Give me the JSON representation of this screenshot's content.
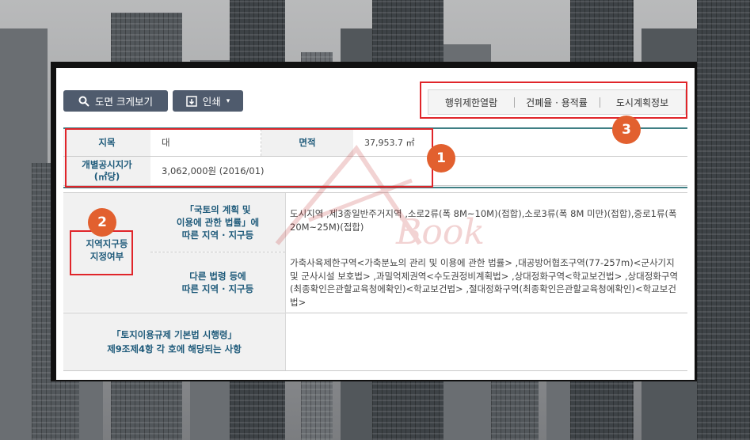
{
  "toolbar": {
    "zoom_button_label": "도면 크게보기",
    "print_button_label": "인쇄",
    "print_caret": "▾"
  },
  "tabs": [
    "행위제한열람",
    "건폐율 · 용적률",
    "도시계획정보"
  ],
  "land_info": {
    "category_label": "지목",
    "category_value": "대",
    "area_label": "면적",
    "area_value": "37,953.7 ㎡",
    "price_label_line1": "개별공시지가",
    "price_label_line2": "(㎡당)",
    "price_value": "3,062,000원 (2016/01)"
  },
  "zoning": {
    "section_label_line1": "지역지구등",
    "section_label_line2": "지정여부",
    "row1_label_line1": "「국토의 계획 및",
    "row1_label_line2": "이용에 관한 법률」에",
    "row1_label_line3": "따른 지역 · 지구등",
    "row1_value": "도시지역 ,제3종일반주거지역 ,소로2류(폭 8M~10M)(접합),소로3류(폭 8M 미만)(접합),중로1류(폭 20M~25M)(접합)",
    "row2_label_line1": "다른 법령 등에",
    "row2_label_line2": "따른 지역 · 지구등",
    "row2_value": "가축사육제한구역<가축분뇨의 관리 및 이용에 관한 법률> ,대공방어협조구역(77-257m)<군사기지 및 군사시설 보호법> ,과밀억제권역<수도권정비계획법> ,상대정화구역<학교보건법> ,상대정화구역(최종확인은관할교육청에확인)<학교보건법> ,절대정화구역(최종확인은관할교육청에확인)<학교보건법>",
    "row3_label_line1": "「토지이용규제 기본법 시행령」",
    "row3_label_line2": "제9조제4항 각 호에 해당되는 사항",
    "row3_value": ""
  },
  "annotations": {
    "badge1": "1",
    "badge2": "2",
    "badge3": "3"
  },
  "colors": {
    "accent_red": "#e0252a",
    "badge_orange": "#e2602f",
    "label_blue": "#1e5a7a",
    "button_slate": "#4f5b6d"
  }
}
